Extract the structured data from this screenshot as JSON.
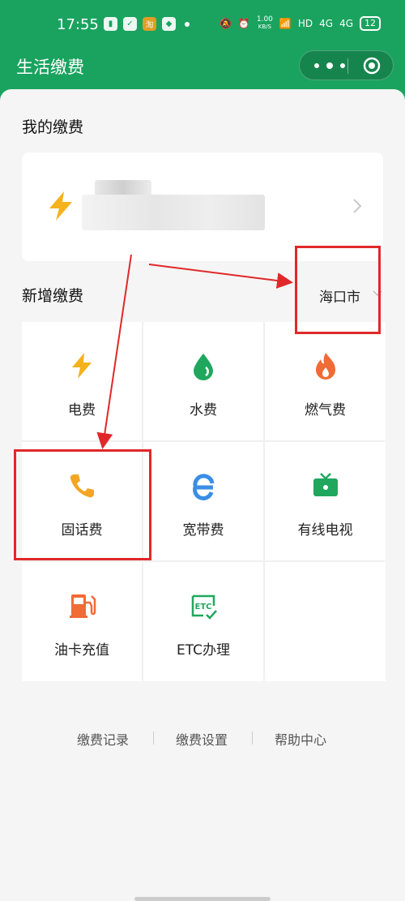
{
  "status_bar": {
    "time": "17:55",
    "net_speed_value": "1.00",
    "net_speed_unit": "KB/S",
    "hd_label": "HD",
    "signal1": "4G",
    "signal2": "4G",
    "battery": "12"
  },
  "header": {
    "title": "生活缴费"
  },
  "my_payments": {
    "section_title": "我的缴费"
  },
  "new_payment": {
    "section_title": "新增缴费",
    "city": "海口市"
  },
  "services": [
    {
      "label": "电费",
      "icon": "lightning-icon",
      "color": "#f4b21c"
    },
    {
      "label": "水费",
      "icon": "water-drop-icon",
      "color": "#20a75e"
    },
    {
      "label": "燃气费",
      "icon": "flame-icon",
      "color": "#f06b35"
    },
    {
      "label": "固话费",
      "icon": "phone-icon",
      "color": "#f4a622"
    },
    {
      "label": "宽带费",
      "icon": "broadband-e-icon",
      "color": "#3a8ee6"
    },
    {
      "label": "有线电视",
      "icon": "tv-icon",
      "color": "#20a75e"
    },
    {
      "label": "油卡充值",
      "icon": "fuel-pump-icon",
      "color": "#f06b35"
    },
    {
      "label": "ETC办理",
      "icon": "etc-icon",
      "color": "#20a75e"
    }
  ],
  "footer_links": {
    "records": "缴费记录",
    "settings": "缴费设置",
    "help": "帮助中心"
  },
  "theme": {
    "brand_green": "#1aa35f",
    "annotation_red": "#e0282a"
  }
}
